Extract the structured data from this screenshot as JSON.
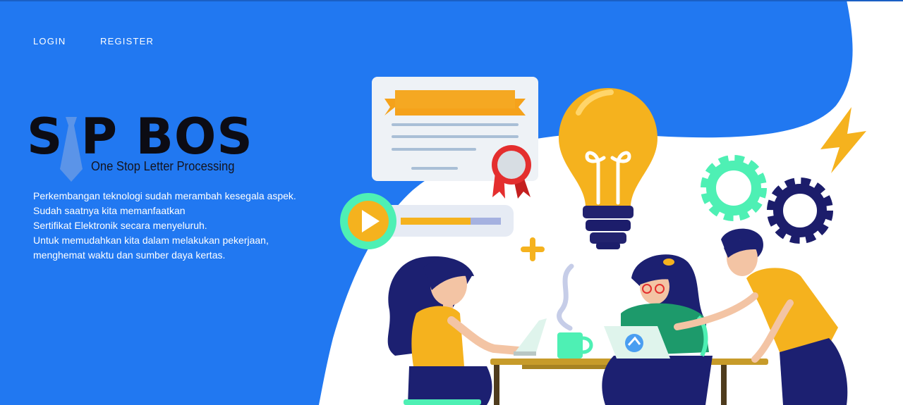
{
  "nav": {
    "login_label": "LOGIN",
    "register_label": "REGISTER"
  },
  "brand": {
    "name": "S P BOS",
    "tagline": "One Stop Letter Processing"
  },
  "description": {
    "lines": [
      "Perkembangan teknologi sudah merambah kesegala aspek.",
      "Sudah saatnya kita memanfaatkan",
      "Sertifikat Elektronik secara menyeluruh.",
      "Untuk memudahkan kita dalam melakukan pekerjaan,",
      "menghemat waktu dan sumber daya kertas."
    ]
  },
  "colors": {
    "primary_blue": "#2178f1",
    "accent_yellow": "#f5b21e",
    "accent_green": "#4ef0b4",
    "navy": "#1c1d6b"
  },
  "video_progress": 0.7
}
